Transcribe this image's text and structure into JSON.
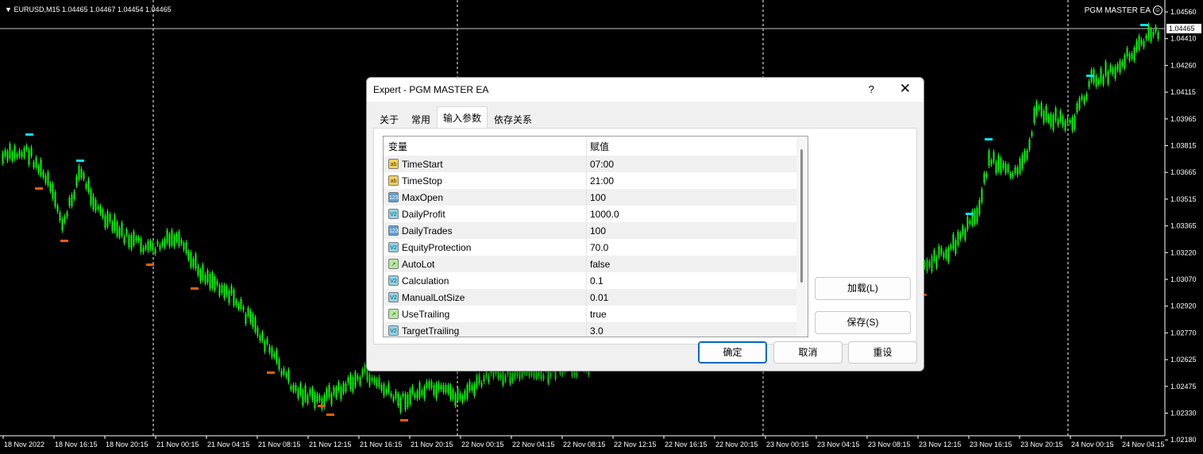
{
  "chart": {
    "symbol_header": "EURUSD,M15  1.04465 1.04467 1.04454 1.04465",
    "ea_name": "PGM MASTER EA",
    "current_price": "1.04465",
    "price_labels": [
      "1.04560",
      "1.04410",
      "1.04260",
      "1.04115",
      "1.03965",
      "1.03815",
      "1.03665",
      "1.03515",
      "1.03365",
      "1.03220",
      "1.03070",
      "1.02920",
      "1.02770",
      "1.02625",
      "1.02475",
      "1.02330",
      "1.02180"
    ],
    "time_labels": [
      "18 Nov 2022",
      "18 Nov 16:15",
      "18 Nov 20:15",
      "21 Nov 00:15",
      "21 Nov 04:15",
      "21 Nov 08:15",
      "21 Nov 12:15",
      "21 Nov 16:15",
      "21 Nov 20:15",
      "22 Nov 00:15",
      "22 Nov 04:15",
      "22 Nov 08:15",
      "22 Nov 12:15",
      "22 Nov 16:15",
      "22 Nov 20:15",
      "23 Nov 00:15",
      "23 Nov 04:15",
      "23 Nov 08:15",
      "23 Nov 12:15",
      "23 Nov 16:15",
      "23 Nov 20:15",
      "24 Nov 00:15",
      "24 Nov 04:15"
    ],
    "colors": {
      "background": "#000000",
      "candle": "#00ff00",
      "high_marker": "#00e5ff",
      "low_marker": "#ff5a00",
      "grid": "#ffffff"
    }
  },
  "dialog": {
    "title": "Expert - PGM MASTER EA",
    "help_label": "?",
    "close_label": "✕",
    "tabs": [
      {
        "label": "关于",
        "active": false
      },
      {
        "label": "常用",
        "active": false
      },
      {
        "label": "输入参数",
        "active": true
      },
      {
        "label": "依存关系",
        "active": false
      }
    ],
    "columns": {
      "variable": "变量",
      "value": "赋值"
    },
    "params": [
      {
        "icon": "string",
        "icon_text": "ab",
        "name": "TimeStart",
        "value": "07:00"
      },
      {
        "icon": "string",
        "icon_text": "ab",
        "name": "TimeStop",
        "value": "21:00"
      },
      {
        "icon": "int",
        "icon_text": "123",
        "name": "MaxOpen",
        "value": "100"
      },
      {
        "icon": "double",
        "icon_text": "V2",
        "name": "DailyProfit",
        "value": "1000.0"
      },
      {
        "icon": "int",
        "icon_text": "123",
        "name": "DailyTrades",
        "value": "100"
      },
      {
        "icon": "double",
        "icon_text": "V2",
        "name": "EquityProtection",
        "value": "70.0"
      },
      {
        "icon": "bool",
        "icon_text": "↗",
        "name": "AutoLot",
        "value": "false"
      },
      {
        "icon": "double",
        "icon_text": "V2",
        "name": "Calculation",
        "value": "0.1"
      },
      {
        "icon": "double",
        "icon_text": "V2",
        "name": "ManualLotSize",
        "value": "0.01"
      },
      {
        "icon": "bool",
        "icon_text": "↗",
        "name": "UseTrailing",
        "value": "true"
      },
      {
        "icon": "double",
        "icon_text": "V2",
        "name": "TargetTrailing",
        "value": "3.0"
      }
    ],
    "load_button": "加载(L)",
    "save_button": "保存(S)",
    "ok_button": "确定",
    "cancel_button": "取消",
    "reset_button": "重设"
  }
}
